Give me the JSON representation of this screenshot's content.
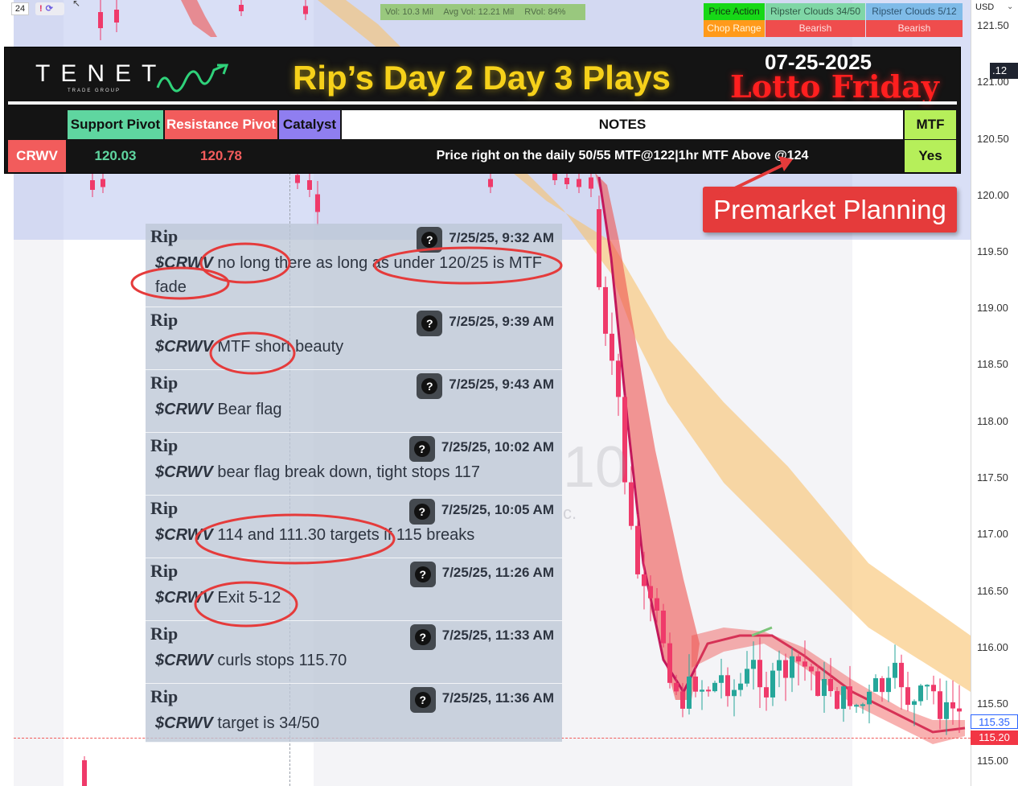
{
  "chart": {
    "interval": "24",
    "alert_icons": [
      "!",
      "⟳"
    ],
    "currency": "USD",
    "price_ticks": [
      "121.50",
      "121.00",
      "120.50",
      "120.00",
      "119.50",
      "119.00",
      "118.50",
      "118.00",
      "117.50",
      "117.00",
      "116.50",
      "116.00",
      "115.50",
      "115.00"
    ],
    "partial_tag": ".12",
    "last_price_blue": "115.35",
    "last_price_red": "115.20",
    "colors": {
      "up": "#26a69a",
      "down": "#ef3a6a",
      "cloud_orange": "#f9c16c",
      "cloud_red": "#ef5350",
      "premarket": "#aab9eb"
    }
  },
  "volume_bar": {
    "vol": "Vol: 10.3 Mil",
    "avg": "Avg Vol: 12.21 Mil",
    "rvol": "RVol: 84%"
  },
  "indicator_table": {
    "price_action": "Price Action",
    "ripster_1": "Ripster Clouds 34/50",
    "ripster_2": "Ripster Clouds 5/12",
    "chop_range": "Chop Range",
    "bearish_1": "Bearish",
    "bearish_2": "Bearish"
  },
  "banner": {
    "logo": "TENET",
    "logo_sub": "TRADE GROUP",
    "title": "Rip’s Day 2 Day 3 Plays",
    "date": "07-25-2025",
    "subtitle": "Lotto Friday",
    "headers": {
      "support": "Support Pivot",
      "resistance": "Resistance Pivot",
      "catalyst": "Catalyst",
      "notes": "NOTES",
      "mtf": "MTF"
    },
    "row": {
      "ticker": "CRWV",
      "support": "120.03",
      "resistance": "120.78",
      "catalyst": "",
      "notes": "Price right on the daily 50/55 MTF@122|1hr MTF Above @124",
      "mtf": "Yes"
    }
  },
  "premarket_label": "Premarket Planning",
  "watermark": {
    "big": "10",
    "small": "c."
  },
  "chat": {
    "messages": [
      {
        "author": "Rip",
        "time": "7/25/25, 9:32 AM",
        "symbol": "$CRWV",
        "text": " no long there as long as under 120/25 is MTF fade"
      },
      {
        "author": "Rip",
        "time": "7/25/25, 9:39 AM",
        "symbol": "$CRWV",
        "text": " MTF short beauty"
      },
      {
        "author": "Rip",
        "time": "7/25/25, 9:43 AM",
        "symbol": "$CRWV",
        "text": " Bear  flag"
      },
      {
        "author": "Rip",
        "time": "7/25/25, 10:02 AM",
        "symbol": "$CRWV",
        "text": " bear flag break down, tight stops 117"
      },
      {
        "author": "Rip",
        "time": "7/25/25, 10:05 AM",
        "symbol": "$CRWV",
        "text": " 114 and 111.30 targets if 115 breaks"
      },
      {
        "author": "Rip",
        "time": "7/25/25, 11:26 AM",
        "symbol": "$CRWV",
        "text": " Exit 5-12"
      },
      {
        "author": "Rip",
        "time": "7/25/25, 11:33 AM",
        "symbol": "$CRWV",
        "text": " curls stops 115.70"
      },
      {
        "author": "Rip",
        "time": "7/25/25, 11:36 AM",
        "symbol": "$CRWV",
        "text": " target is 34/50"
      }
    ]
  }
}
